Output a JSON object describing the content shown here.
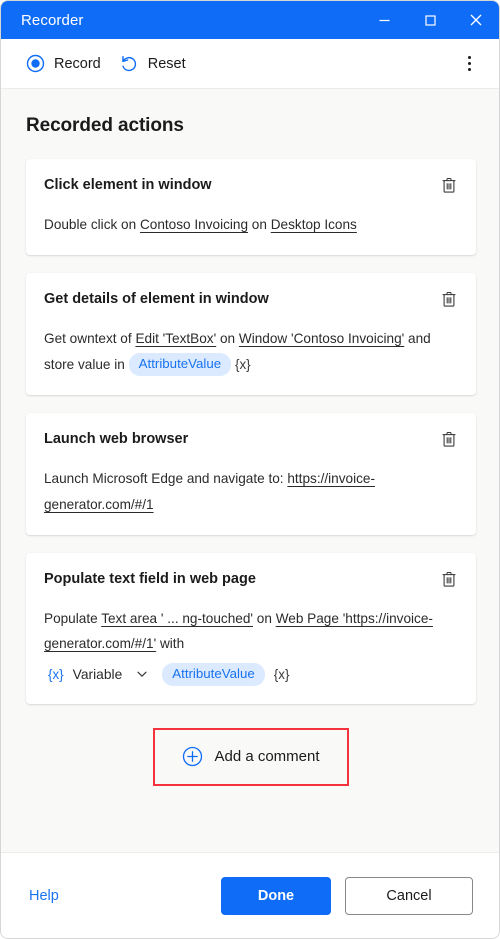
{
  "window": {
    "title": "Recorder",
    "controls": {
      "minimize": "minimize-icon",
      "maximize": "maximize-icon",
      "close": "close-icon"
    }
  },
  "toolbar": {
    "record_label": "Record",
    "reset_label": "Reset",
    "overflow_label": "More options"
  },
  "main": {
    "section_title": "Recorded actions",
    "cards": [
      {
        "title": "Click element in window",
        "segments": [
          {
            "type": "text",
            "text": "Double click on "
          },
          {
            "type": "link",
            "text": "Contoso Invoicing"
          },
          {
            "type": "text",
            "text": " on "
          },
          {
            "type": "link",
            "text": "Desktop Icons"
          }
        ]
      },
      {
        "title": "Get details of element in window",
        "segments": [
          {
            "type": "text",
            "text": "Get owntext of "
          },
          {
            "type": "link",
            "text": "Edit 'TextBox'"
          },
          {
            "type": "text",
            "text": " on "
          },
          {
            "type": "link",
            "text": "Window 'Contoso Invoicing'"
          },
          {
            "type": "text",
            "text": " and store value in "
          },
          {
            "type": "pill",
            "text": "AttributeValue"
          },
          {
            "type": "varmark",
            "text": "{x}"
          }
        ]
      },
      {
        "title": "Launch web browser",
        "segments": [
          {
            "type": "text",
            "text": "Launch Microsoft Edge and navigate to: "
          },
          {
            "type": "link",
            "text": "https://invoice-generator.com/#/1"
          }
        ]
      },
      {
        "title": "Populate text field in web page",
        "segments": [
          {
            "type": "text",
            "text": "Populate "
          },
          {
            "type": "link",
            "text": "Text area ' ...  ng-touched'"
          },
          {
            "type": "text",
            "text": " on "
          },
          {
            "type": "link",
            "text": "Web Page 'https://invoice-generator.com/#/1'"
          },
          {
            "type": "text",
            "text": " with"
          }
        ],
        "variable_row": {
          "prefix_mark": "{x}",
          "selected": "Variable",
          "chevron": "chevron-down-icon",
          "pill": "AttributeValue",
          "suffix_mark": "{x}"
        }
      }
    ],
    "add_comment_label": "Add a comment",
    "highlight_color": "#f4333d"
  },
  "footer": {
    "help_label": "Help",
    "done_label": "Done",
    "cancel_label": "Cancel"
  },
  "colors": {
    "titlebar": "#0f6cf7",
    "accent": "#0f6cf7",
    "pill_bg": "#dbeaff",
    "pill_text": "#1a73f0",
    "page_bg": "#f9f9f8"
  }
}
